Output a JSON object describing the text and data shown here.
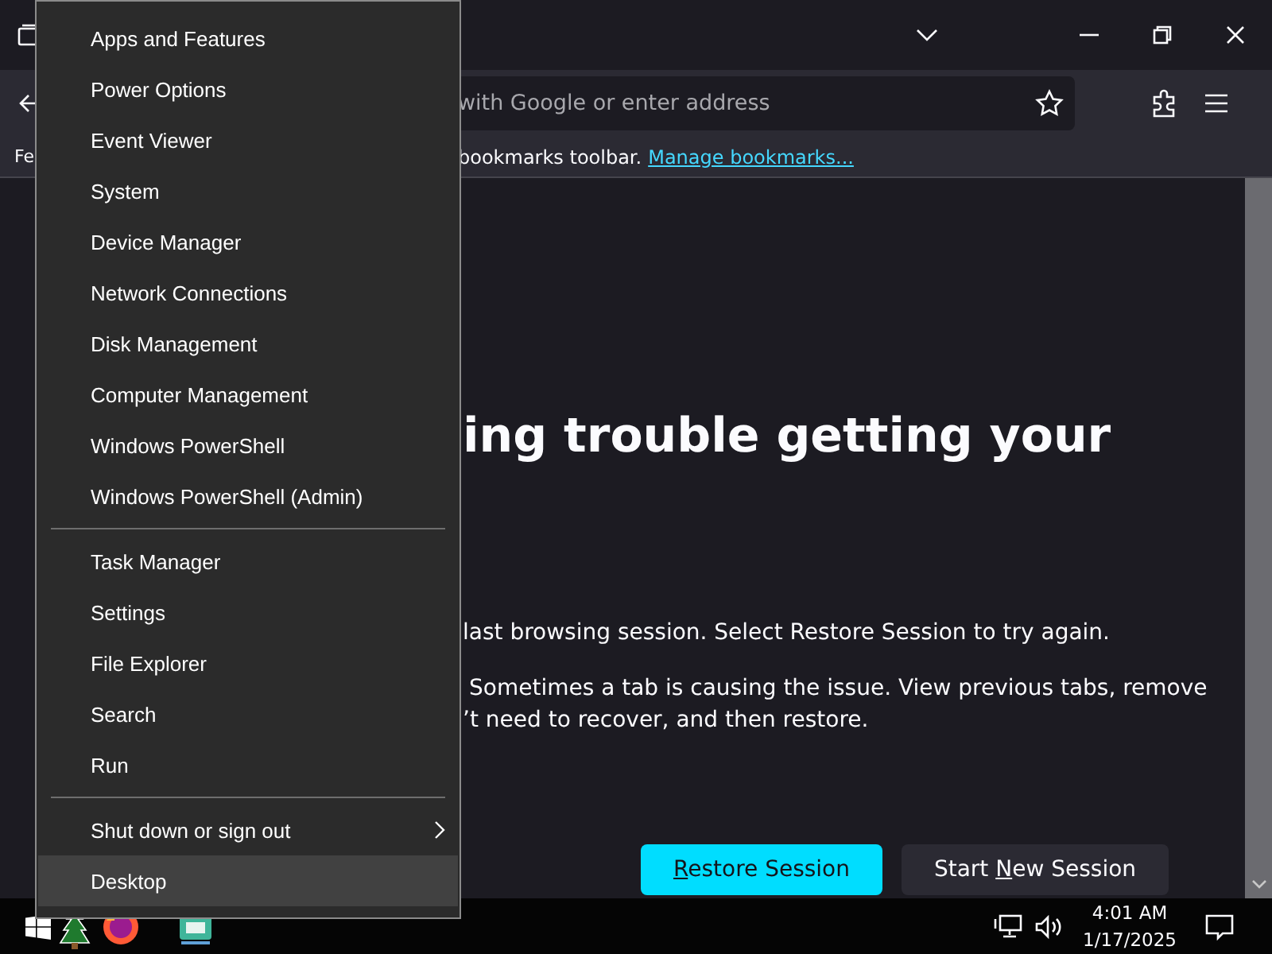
{
  "browser": {
    "address_bar": {
      "placeholder": "with Google or enter address"
    },
    "bookmarks_bar": {
      "leading_text": "Fe",
      "text": "bookmarks toolbar.",
      "link": "Manage bookmarks..."
    },
    "content": {
      "heading": "ing trouble getting your",
      "paragraphs": [
        {
          "lines": [
            "last browsing session. Select Restore Session to try again."
          ]
        },
        {
          "lines": [
            "Sometimes a tab is causing the issue. View previous tabs, remove",
            "’t need to recover, and then restore."
          ]
        }
      ],
      "buttons": [
        {
          "kind": "primary",
          "access_key": "R",
          "after": "estore Session"
        },
        {
          "kind": "secondary",
          "before": "Start ",
          "access_key": "N",
          "after": "ew Session"
        }
      ]
    }
  },
  "context_menu": {
    "groups": [
      {
        "items": [
          {
            "label": "Apps and Features",
            "selected": false,
            "has_submenu": false
          },
          {
            "label": "Power Options",
            "selected": false,
            "has_submenu": false
          },
          {
            "label": "Event Viewer",
            "selected": false,
            "has_submenu": false
          },
          {
            "label": "System",
            "selected": false,
            "has_submenu": false
          },
          {
            "label": "Device Manager",
            "selected": false,
            "has_submenu": false
          },
          {
            "label": "Network Connections",
            "selected": false,
            "has_submenu": false
          },
          {
            "label": "Disk Management",
            "selected": false,
            "has_submenu": false
          },
          {
            "label": "Computer Management",
            "selected": false,
            "has_submenu": false
          },
          {
            "label": "Windows PowerShell",
            "selected": false,
            "has_submenu": false
          },
          {
            "label": "Windows PowerShell (Admin)",
            "selected": false,
            "has_submenu": false
          }
        ]
      },
      {
        "items": [
          {
            "label": "Task Manager",
            "selected": false,
            "has_submenu": false
          },
          {
            "label": "Settings",
            "selected": false,
            "has_submenu": false
          },
          {
            "label": "File Explorer",
            "selected": false,
            "has_submenu": false
          },
          {
            "label": "Search",
            "selected": false,
            "has_submenu": false
          },
          {
            "label": "Run",
            "selected": false,
            "has_submenu": false
          }
        ]
      },
      {
        "items": [
          {
            "label": "Shut down or sign out",
            "selected": false,
            "has_submenu": true
          },
          {
            "label": "Desktop",
            "selected": true,
            "has_submenu": false
          }
        ]
      }
    ]
  },
  "taskbar": {
    "clock": {
      "time": "4:01 AM",
      "date": "1/17/2025"
    }
  }
}
